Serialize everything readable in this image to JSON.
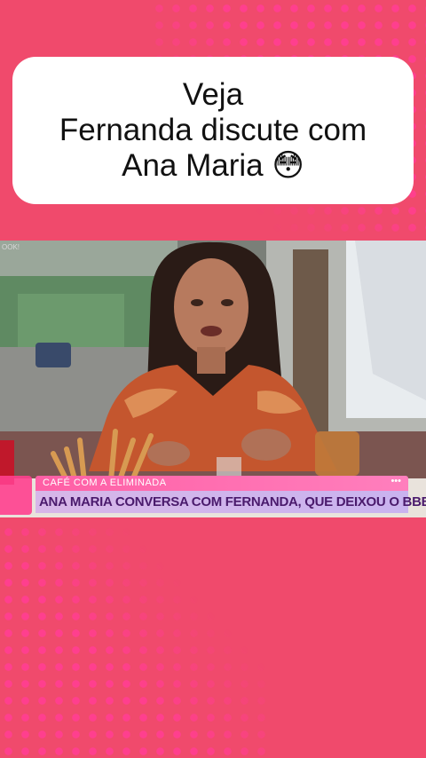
{
  "title_card": {
    "line1": "Veja",
    "line2": "Fernanda discute com",
    "line3": "Ana Maria 😳"
  },
  "video": {
    "studio_tag": "OOK!",
    "lower_third": {
      "top_label": "CAFÉ COM A ELIMINADA",
      "headline": "ANA MARIA CONVERSA COM FERNANDA, QUE DEIXOU O BBB",
      "menu_dots": "•••"
    }
  },
  "colors": {
    "background": "#f04a6c",
    "dots": "#ff3f8e",
    "card": "#ffffff",
    "lower_third_pink": "#ff5fa5",
    "lower_third_lilac": "#d7b6e8"
  }
}
